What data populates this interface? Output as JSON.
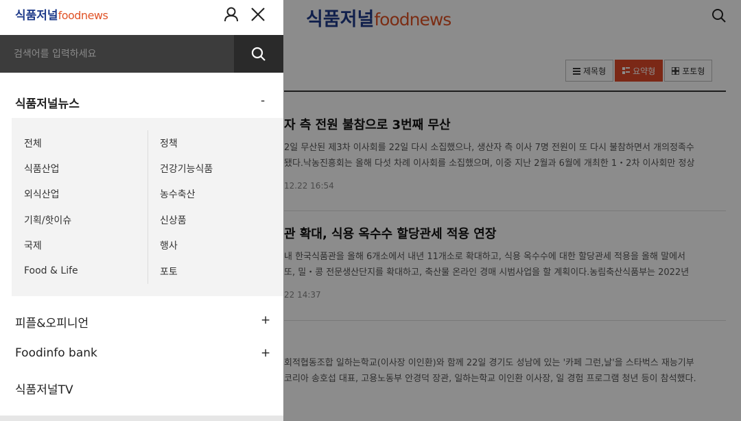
{
  "background": {
    "logo_ko": "식품저널",
    "logo_en": "foodnews",
    "view_buttons": [
      "제목형",
      "요약형",
      "포토형"
    ],
    "articles": [
      {
        "title": "자 측 전원 불참으로 3번째 무산",
        "summary_line1": "2일 무산된 제3차 이사회를 22일 다시 소집했으나, 생산자 측 이사 7명 전원이 또 다시 불참하면서 개의정족수",
        "summary_line2": "됐다.낙농진흥회는 올해 다섯 차례 이사회를 소집했으며, 이중 지난 2월과 6월에 개최한 1・2차 이사회만 정상",
        "date": "12.22 16:54"
      },
      {
        "title": "관 확대, 식용 옥수수 할당관세 적용 연장",
        "summary_line1": "내 한국식품관을 올해 6개소에서 내년 11개소로 확대하고, 식용 옥수수에 대한 할당관세 적용을 올해 말에서",
        "summary_line2": "또, 밀・콩 전문생산단지를 확대하고, 축산물 온라인 경매 시범사업을 할 계획이다.농림축산식품부는 2022년",
        "date": "22 14:37"
      },
      {
        "summary_line1": "회적협동조합 일하는학교(이사장 이인환)와 함께 22일 경기도 성남에 있는 '카페 그런,날'을 스타벅스 재능기부",
        "summary_line2": "코리아 송호섭 대표, 고용노동부 안경덕 장관, 일하는학교 이인환 이사장, 일 경험 프로그램 청년 등이 참석했다."
      }
    ]
  },
  "drawer": {
    "logo_ko": "식품저널",
    "logo_en": "foodnews",
    "search_placeholder": "검색어를 입력하세요",
    "sections": [
      {
        "title": "식품저널뉴스",
        "toggle": "-",
        "left_items": [
          "전체",
          "식품산업",
          "외식산업",
          "기획/핫이슈",
          "국제",
          "Food & Life"
        ],
        "right_items": [
          "정책",
          "건강기능식품",
          "농수축산",
          "신상품",
          "행사",
          "포토"
        ]
      },
      {
        "title": "피플&오피니언",
        "toggle": "+"
      },
      {
        "title": "Foodinfo bank",
        "toggle": "+"
      },
      {
        "title": "식품저널TV"
      }
    ]
  },
  "colors": {
    "brand_blue": "#1f3b8a",
    "brand_orange": "#e05226",
    "active_view": "#e14a28",
    "search_bar": "#3c3c3c"
  },
  "icons": {
    "user": "user-icon",
    "close": "close-icon",
    "search": "search-icon"
  }
}
